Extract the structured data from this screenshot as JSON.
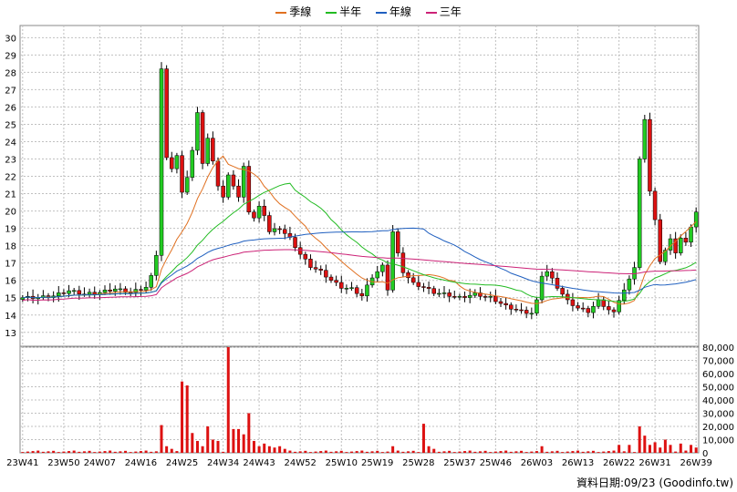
{
  "legend": [
    {
      "label": "季線",
      "color": "#e07020"
    },
    {
      "label": "半年",
      "color": "#22bb22"
    },
    {
      "label": "年線",
      "color": "#1f5fbf"
    },
    {
      "label": "三年",
      "color": "#cc2277"
    }
  ],
  "footer": {
    "label": "資料日期:",
    "date": "09/23",
    "source": "(Goodinfo.tw)"
  },
  "chart_data": {
    "type": "candlestick",
    "price_axis": {
      "ticks": [
        13,
        14,
        15,
        16,
        17,
        18,
        19,
        20,
        21,
        22,
        23,
        24,
        25,
        26,
        27,
        28,
        29,
        30
      ],
      "ylim": [
        12.2,
        30.7
      ]
    },
    "volume_axis": {
      "ticks": [
        "0",
        "10,000",
        "20,000",
        "30,000",
        "40,000",
        "50,000",
        "60,000",
        "70,000",
        "80,000"
      ],
      "ylim": [
        0,
        80000
      ]
    },
    "x_ticks": [
      "23W41",
      "23W50",
      "24W07",
      "24W16",
      "24W25",
      "24W34",
      "24W43",
      "24W52",
      "25W10",
      "25W19",
      "25W28",
      "25W37",
      "25W46",
      "26W03",
      "26W13",
      "26W22",
      "26W31",
      "26W39"
    ],
    "colors": {
      "up": "#22cc22",
      "down": "#dd1111",
      "volume": "#dd1111",
      "grid": "#c0c0c0"
    },
    "close_anchors": [
      [
        0,
        15.0
      ],
      [
        3,
        15.0
      ],
      [
        6,
        15.1
      ],
      [
        9,
        15.4
      ],
      [
        12,
        15.2
      ],
      [
        15,
        15.3
      ],
      [
        18,
        15.5
      ],
      [
        21,
        15.3
      ],
      [
        24,
        15.6
      ],
      [
        25,
        16.2
      ],
      [
        26,
        17.5
      ],
      [
        27,
        28.2
      ],
      [
        28,
        23.0
      ],
      [
        29,
        22.5
      ],
      [
        30,
        23.2
      ],
      [
        31,
        21.0
      ],
      [
        32,
        22.0
      ],
      [
        33,
        23.5
      ],
      [
        34,
        25.6
      ],
      [
        35,
        22.8
      ],
      [
        36,
        24.2
      ],
      [
        37,
        22.8
      ],
      [
        38,
        21.5
      ],
      [
        39,
        20.8
      ],
      [
        40,
        22.0
      ],
      [
        41,
        21.5
      ],
      [
        42,
        20.8
      ],
      [
        43,
        22.5
      ],
      [
        44,
        20.0
      ],
      [
        45,
        19.6
      ],
      [
        46,
        20.2
      ],
      [
        47,
        19.8
      ],
      [
        48,
        18.8
      ],
      [
        50,
        19.0
      ],
      [
        52,
        18.4
      ],
      [
        54,
        17.5
      ],
      [
        56,
        16.8
      ],
      [
        58,
        16.5
      ],
      [
        60,
        16.0
      ],
      [
        62,
        15.6
      ],
      [
        64,
        15.5
      ],
      [
        66,
        15.1
      ],
      [
        68,
        16.2
      ],
      [
        70,
        16.8
      ],
      [
        71,
        15.5
      ],
      [
        72,
        18.8
      ],
      [
        73,
        17.5
      ],
      [
        74,
        16.5
      ],
      [
        76,
        15.8
      ],
      [
        78,
        15.6
      ],
      [
        80,
        15.3
      ],
      [
        82,
        15.2
      ],
      [
        85,
        15.0
      ],
      [
        88,
        15.2
      ],
      [
        91,
        15.0
      ],
      [
        94,
        14.5
      ],
      [
        97,
        14.2
      ],
      [
        99,
        14.1
      ],
      [
        100,
        14.8
      ],
      [
        101,
        16.3
      ],
      [
        102,
        16.5
      ],
      [
        104,
        15.6
      ],
      [
        106,
        14.8
      ],
      [
        108,
        14.4
      ],
      [
        110,
        14.2
      ],
      [
        112,
        14.8
      ],
      [
        114,
        14.3
      ],
      [
        115,
        14.1
      ],
      [
        116,
        14.9
      ],
      [
        118,
        16.0
      ],
      [
        119,
        16.8
      ],
      [
        120,
        23.0
      ],
      [
        121,
        25.2
      ],
      [
        122,
        21.2
      ],
      [
        123,
        19.5
      ],
      [
        124,
        17.0
      ],
      [
        125,
        17.8
      ],
      [
        126,
        18.4
      ],
      [
        127,
        17.5
      ],
      [
        128,
        18.5
      ],
      [
        129,
        18.2
      ],
      [
        130,
        19.0
      ],
      [
        131,
        20.0
      ]
    ],
    "volume_events": [
      [
        27,
        21000
      ],
      [
        28,
        5000
      ],
      [
        29,
        3000
      ],
      [
        31,
        54000
      ],
      [
        32,
        51000
      ],
      [
        33,
        15000
      ],
      [
        34,
        9000
      ],
      [
        35,
        5000
      ],
      [
        36,
        20000
      ],
      [
        37,
        10000
      ],
      [
        38,
        9000
      ],
      [
        40,
        82000
      ],
      [
        41,
        18000
      ],
      [
        42,
        18000
      ],
      [
        43,
        14000
      ],
      [
        44,
        30000
      ],
      [
        45,
        9000
      ],
      [
        46,
        5000
      ],
      [
        47,
        7000
      ],
      [
        48,
        5000
      ],
      [
        49,
        4000
      ],
      [
        50,
        5000
      ],
      [
        51,
        3000
      ],
      [
        72,
        5000
      ],
      [
        78,
        22000
      ],
      [
        79,
        5000
      ],
      [
        80,
        3000
      ],
      [
        101,
        5000
      ],
      [
        116,
        6000
      ],
      [
        118,
        6000
      ],
      [
        120,
        20000
      ],
      [
        121,
        13000
      ],
      [
        122,
        6000
      ],
      [
        123,
        8000
      ],
      [
        124,
        4000
      ],
      [
        125,
        10000
      ],
      [
        126,
        6000
      ],
      [
        128,
        7000
      ],
      [
        130,
        6000
      ],
      [
        131,
        4000
      ]
    ]
  }
}
